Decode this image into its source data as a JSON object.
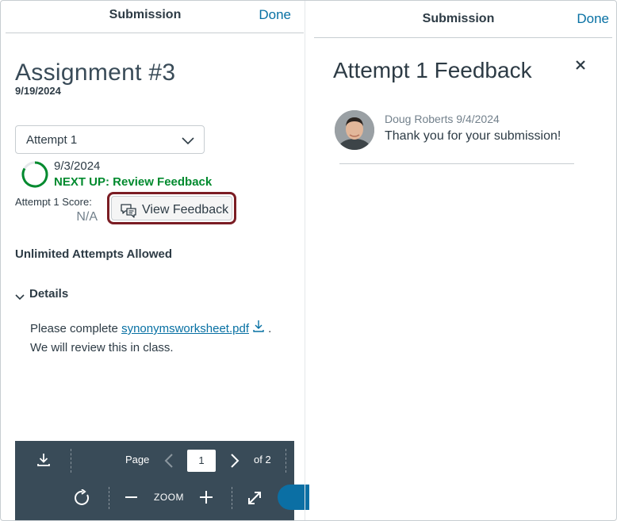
{
  "left": {
    "header": {
      "title": "Submission",
      "done_label": "Done"
    },
    "assignment": {
      "title": "Assignment #3",
      "due_date": "9/19/2024"
    },
    "attempt_select": {
      "selected": "Attempt 1"
    },
    "status": {
      "date": "9/3/2024",
      "next_up": "NEXT UP: Review Feedback"
    },
    "score": {
      "label": "Attempt 1 Score:",
      "value": "N/A"
    },
    "view_feedback_label": "View Feedback",
    "attempts_allowed": "Unlimited Attempts Allowed",
    "details": {
      "label": "Details",
      "text_before": "Please complete ",
      "link": "synonymsworksheet.pdf",
      "text_after": " .",
      "line2": "We will review this in class."
    },
    "pdf_toolbar": {
      "page_label": "Page",
      "page_value": "1",
      "of_label": "of 2",
      "zoom_label": "ZOOM"
    }
  },
  "right": {
    "header": {
      "title": "Submission",
      "done_label": "Done"
    },
    "feedback_title": "Attempt 1 Feedback",
    "comment": {
      "author_date": "Doug Roberts 9/4/2024",
      "text": "Thank you for your submission!"
    }
  },
  "colors": {
    "link_blue": "#0770a3",
    "success_green": "#008a2e",
    "highlight_border": "#7b1d24",
    "toolbar_bg": "#394b58"
  },
  "icons": [
    "chevron-down-icon",
    "progress-ring-icon",
    "feedback-chat-icon",
    "download-icon",
    "rotate-icon",
    "zoom-out-icon",
    "zoom-in-icon",
    "expand-icon",
    "close-icon"
  ]
}
